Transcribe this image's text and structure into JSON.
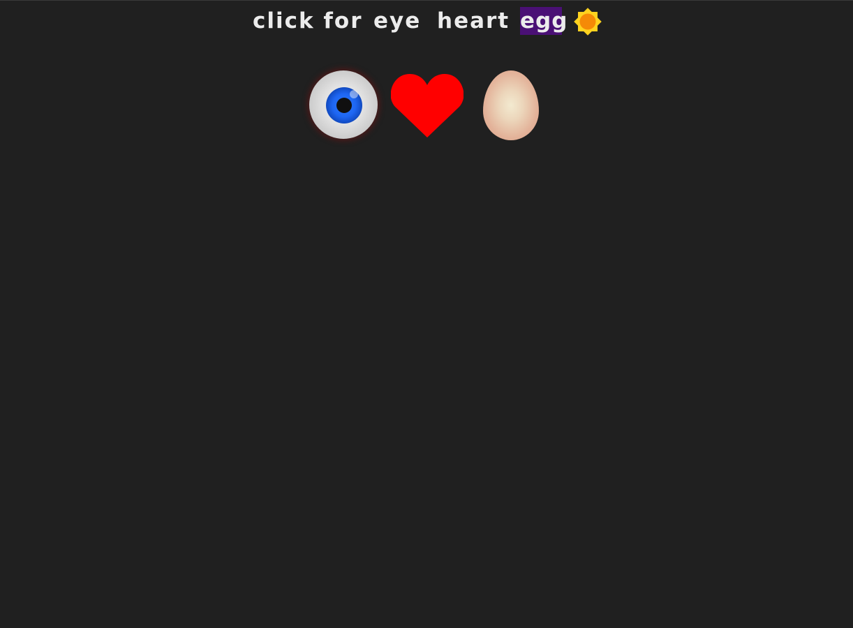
{
  "menu": {
    "label": "click for",
    "options": [
      "eye",
      "heart",
      "egg"
    ],
    "selected": "egg"
  },
  "theme_toggle": {
    "icon": "sun-icon"
  },
  "colors": {
    "background": "#202020",
    "text": "#ececec",
    "selected_highlight": "#4a1075",
    "sun_outer": "#ffd21f",
    "sun_inner": "#f58a07",
    "heart": "#ff0000",
    "iris": "#1e66f2"
  },
  "shapes": [
    "eye",
    "heart",
    "egg"
  ]
}
